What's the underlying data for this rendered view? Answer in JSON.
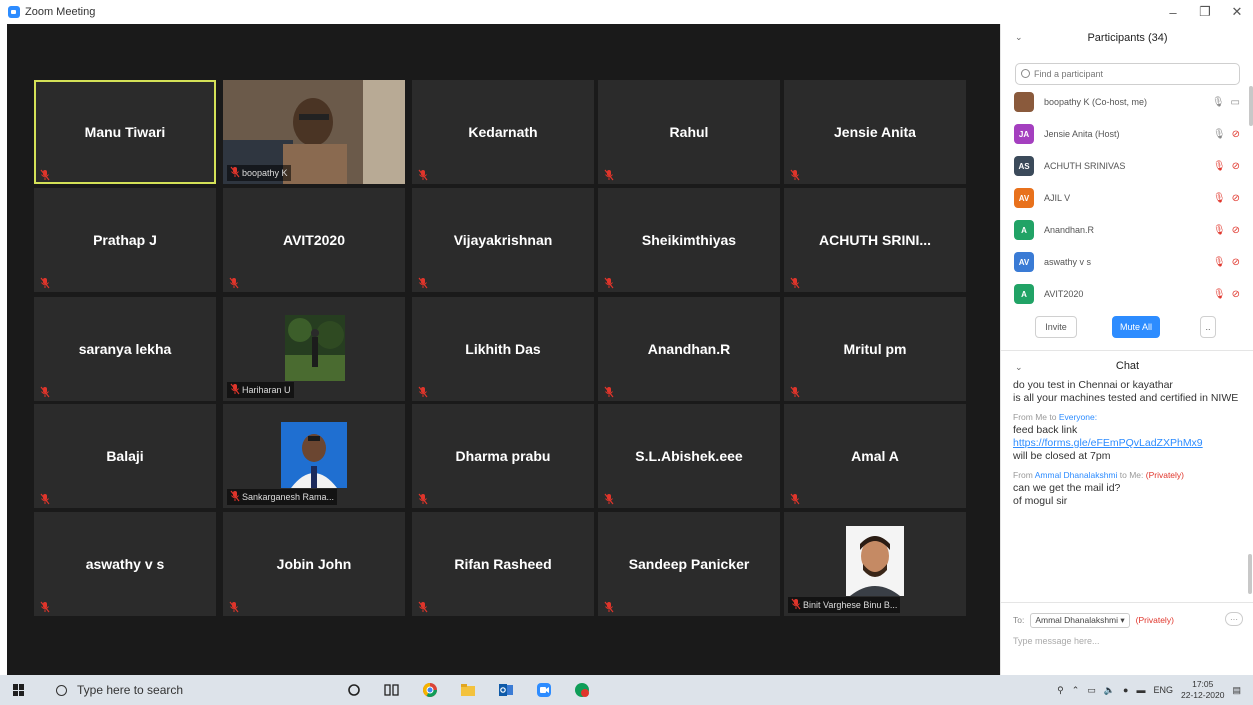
{
  "window": {
    "title": "Zoom Meeting",
    "minimize": "–",
    "restore": "❐",
    "close": "✕"
  },
  "tiles": [
    {
      "name": "Manu Tiwari",
      "active": true
    },
    {
      "name": "",
      "label": "boopathy K",
      "video": "person"
    },
    {
      "name": "Kedarnath"
    },
    {
      "name": "Rahul"
    },
    {
      "name": "Jensie Anita"
    },
    {
      "name": "Prathap J"
    },
    {
      "name": "AVIT2020"
    },
    {
      "name": "Vijayakrishnan"
    },
    {
      "name": "Sheikimthiyas"
    },
    {
      "name": "ACHUTH SRINI..."
    },
    {
      "name": "saranya lekha"
    },
    {
      "name": "",
      "label": "Hariharan U",
      "video": "forest"
    },
    {
      "name": "Likhith Das"
    },
    {
      "name": "Anandhan.R"
    },
    {
      "name": "Mritul pm"
    },
    {
      "name": "Balaji"
    },
    {
      "name": "",
      "label": "Sankarganesh Rama...",
      "video": "portrait-blue"
    },
    {
      "name": "Dharma prabu"
    },
    {
      "name": "S.L.Abishek.eee"
    },
    {
      "name": "Amal A"
    },
    {
      "name": "aswathy v s"
    },
    {
      "name": "Jobin John"
    },
    {
      "name": "Rifan Rasheed"
    },
    {
      "name": "Sandeep Panicker"
    },
    {
      "name": "",
      "label": "Binit Varghese Binu B...",
      "video": "portrait-white"
    }
  ],
  "participants": {
    "header": "Participants (34)",
    "search_placeholder": "Find a participant",
    "list": [
      {
        "initials": "",
        "name": "boopathy K (Co-host, me)",
        "color": "#8a5a3c",
        "mic": "gray",
        "cam": "gray"
      },
      {
        "initials": "JA",
        "name": "Jensie Anita (Host)",
        "color": "#a43fbf",
        "mic": "gray",
        "cam": "red"
      },
      {
        "initials": "AS",
        "name": "ACHUTH SRINIVAS",
        "color": "#3b4a5a",
        "mic": "red",
        "cam": "red"
      },
      {
        "initials": "AV",
        "name": "AJIL V",
        "color": "#e8711c",
        "mic": "red",
        "cam": "red"
      },
      {
        "initials": "A",
        "name": "Anandhan.R",
        "color": "#21a366",
        "mic": "red",
        "cam": "red"
      },
      {
        "initials": "AV",
        "name": "aswathy v s",
        "color": "#3a7bd5",
        "mic": "red",
        "cam": "red"
      },
      {
        "initials": "A",
        "name": "AVIT2020",
        "color": "#21a366",
        "mic": "red",
        "cam": "red"
      }
    ],
    "invite": "Invite",
    "mute_all": "Mute All",
    "more": ".."
  },
  "chat": {
    "header": "Chat",
    "msg1": "do you test in Chennai or kayathar",
    "msg2": "is all your machines tested  and certified in NIWE",
    "meta2_from": "From Me to ",
    "meta2_to": "Everyone:",
    "msg3": "feed back link",
    "link": "https://forms.gle/eFEmPQvLadZXPhMx9",
    "msg4": "will be closed at 7pm",
    "meta3_from": "From ",
    "meta3_name": "Ammal Dhanalakshmi",
    "meta3_to": " to Me: ",
    "meta3_priv": "(Privately)",
    "msg5": "can we get the mail id?",
    "msg6": "of mogul sir",
    "to_label": "To:",
    "to_value": "Ammal Dhanalakshmi ▾",
    "to_priv": "(Privately)",
    "to_more": "···",
    "input_placeholder": "Type message here..."
  },
  "taskbar": {
    "search_placeholder": "Type here to search",
    "lang": "ENG",
    "time": "17:05",
    "date": "22-12-2020"
  }
}
